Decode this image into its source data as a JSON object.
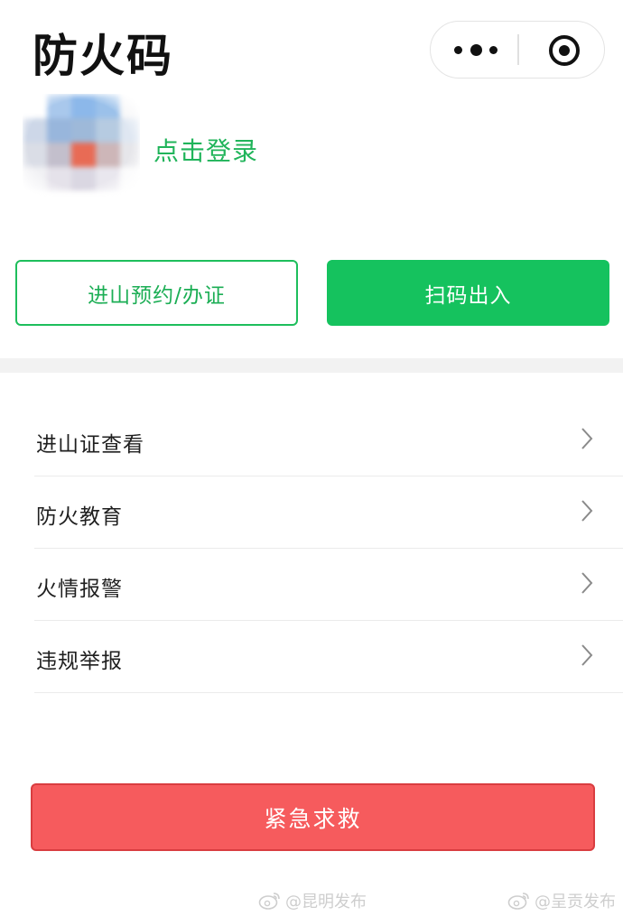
{
  "header": {
    "title": "防火码"
  },
  "capsule": {
    "more_icon": "ellipsis-icon",
    "close_icon": "target-close-icon"
  },
  "profile": {
    "avatar_icon": "pixelated-avatar",
    "login_label": "点击登录"
  },
  "actions": {
    "reserve_label": "进山预约/办证",
    "scan_label": "扫码出入"
  },
  "menu": {
    "items": [
      {
        "label": "进山证查看"
      },
      {
        "label": "防火教育"
      },
      {
        "label": "火情报警"
      },
      {
        "label": "违规举报"
      }
    ]
  },
  "emergency": {
    "label": "紧急求救"
  },
  "watermarks": [
    {
      "text": "@昆明发布"
    },
    {
      "text": "@呈贡发布"
    }
  ],
  "colors": {
    "brand_green": "#15c25e",
    "outline_green": "#1ebe5c",
    "login_green": "#20b45a",
    "emergency_red": "#f65b5d",
    "emergency_border": "#d93d40"
  }
}
